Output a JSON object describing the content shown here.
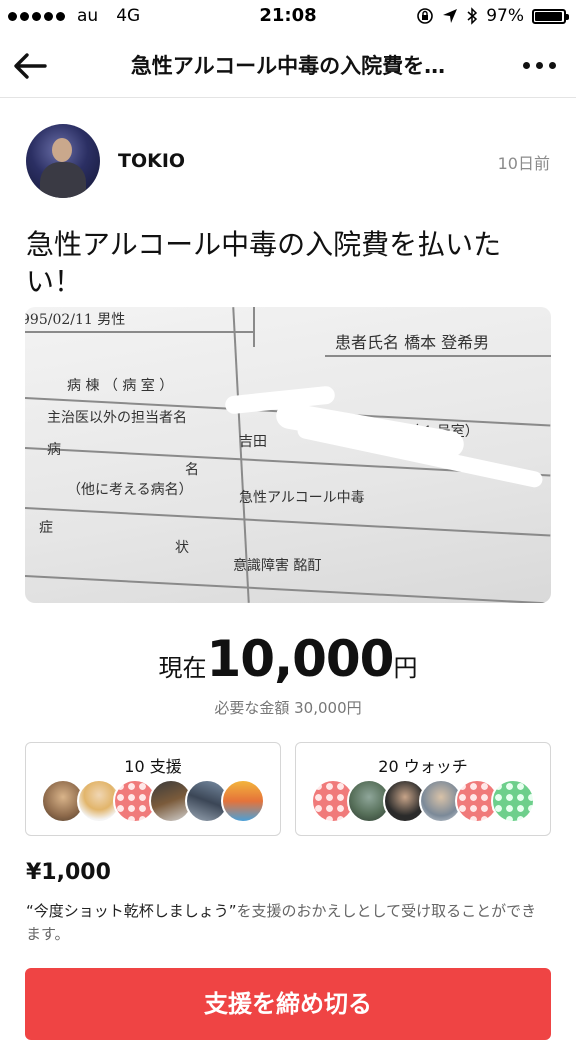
{
  "status_bar": {
    "carrier": "au",
    "network": "4G",
    "time": "21:08",
    "battery": "97%",
    "battery_level": 0.97
  },
  "nav": {
    "title": "急性アルコール中毒の入院費を…",
    "back_icon": "arrow-left-icon",
    "more_icon": "more-horizontal-icon"
  },
  "post": {
    "author": "TOKIO",
    "posted": "10日前",
    "title": "急性アルコール中毒の入院費を払いたい！"
  },
  "photo": {
    "lines": [
      "995/02/11 男性",
      "患者氏名 橋本 登希男",
      "病 棟 （ 病 室 ）",
      "（ 1 号室）",
      "主治医以外の担当者名",
      "吉田",
      "病",
      "名",
      "（他に考える病名）",
      "急性アルコール中毒",
      "症",
      "状",
      "意識障害 酩酊"
    ]
  },
  "funding": {
    "current_prefix": "現在",
    "current_amount": "10,000",
    "current_unit": "円",
    "goal_label": "必要な金額",
    "goal_amount": "30,000円"
  },
  "supporters": {
    "label": "10 支援"
  },
  "watchers": {
    "label": "20 ウォッチ"
  },
  "reward": {
    "price": "¥1,000",
    "quote": "“今度ショット乾杯しましょう”",
    "description": "を支援のおかえしとして受け取ることができます。"
  },
  "cta": {
    "label": "支援を締め切る",
    "color": "#ef4444"
  }
}
